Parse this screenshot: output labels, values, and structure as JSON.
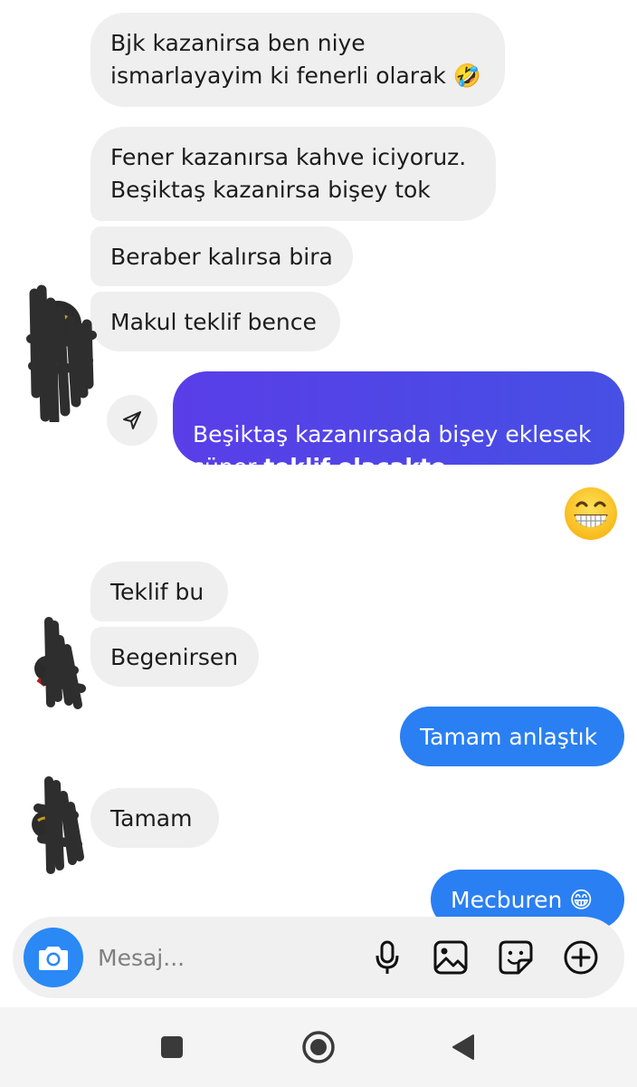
{
  "messages": [
    {
      "text": "Bjk kazanirsa ben niye\nismarlayayim ki fenerli olarak 🤣"
    },
    {
      "text": "Fener kazanırsa kahve iciyoruz.\nBeşiktaş kazanirsa bişey tok"
    },
    {
      "text": "Beraber kalırsa bira"
    },
    {
      "text": "Makul teklif bence"
    },
    {
      "text_plain": "Beşiktaş kazanırsada bişey eklesek\nsüper ",
      "text_bold": "teklif.olacakto"
    },
    {
      "text": "Teklif bu"
    },
    {
      "text": "Begenirsen"
    },
    {
      "text": "Tamam anlaştık"
    },
    {
      "text": "Tamam"
    },
    {
      "text": "Mecburen 😁"
    }
  ],
  "composer": {
    "placeholder": "Mesaj..."
  },
  "colors": {
    "incoming_bubble": "#efefef",
    "outgoing_blue": "#2a7ff2",
    "outgoing_purple": "#5a3ee8",
    "camera_button": "#2a89f5"
  },
  "icons": {
    "share": "paper-plane-icon",
    "camera": "camera-icon",
    "mic": "microphone-icon",
    "gallery": "image-icon",
    "sticker": "sticker-icon",
    "more": "plus-circle-icon",
    "nav_recent": "square-icon",
    "nav_home": "circle-icon",
    "nav_back": "triangle-back-icon"
  }
}
